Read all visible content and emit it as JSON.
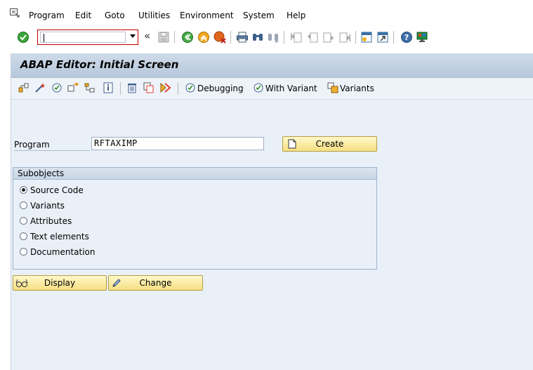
{
  "menu": {
    "items": [
      "Program",
      "Edit",
      "Goto",
      "Utilities",
      "Environment",
      "System",
      "Help"
    ]
  },
  "toolbar": {
    "command_value": "",
    "icons": [
      "enter-icon",
      "command-field",
      "collapse-icon",
      "save-icon",
      "back-icon",
      "exit-icon",
      "cancel-icon",
      "print-icon",
      "find-icon",
      "find-next-icon",
      "first-page-icon",
      "previous-page-icon",
      "next-page-icon",
      "last-page-icon",
      "create-session-icon",
      "generate-shortcut-icon",
      "help-icon",
      "customize-layout-icon"
    ]
  },
  "screen": {
    "title": "ABAP Editor: Initial Screen"
  },
  "app_toolbar": {
    "debugging_label": "Debugging",
    "with_variant_label": "With Variant",
    "variants_label": "Variants"
  },
  "form": {
    "program_label": "Program",
    "program_value": "RFTAXIMP",
    "create_label": "Create"
  },
  "subobjects": {
    "title": "Subobjects",
    "options": [
      {
        "label": "Source Code",
        "selected": true
      },
      {
        "label": "Variants",
        "selected": false
      },
      {
        "label": "Attributes",
        "selected": false
      },
      {
        "label": "Text elements",
        "selected": false
      },
      {
        "label": "Documentation",
        "selected": false
      }
    ]
  },
  "actions": {
    "display_label": "Display",
    "change_label": "Change"
  },
  "colors": {
    "accent_button": "#f6df82",
    "title_bar": "#c3d3e5",
    "background": "#e9f0f8"
  }
}
